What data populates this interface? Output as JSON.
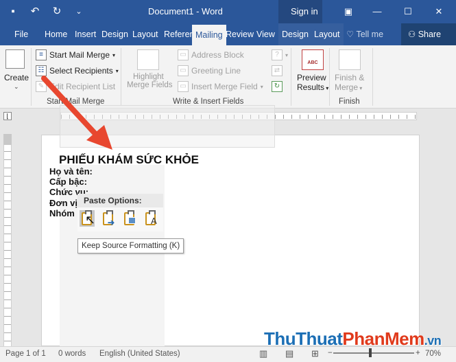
{
  "window": {
    "doc_title": "Document1  -  Word",
    "signin": "Sign in"
  },
  "qat": [
    "save-icon",
    "undo-icon",
    "redo-icon",
    "customize-icon"
  ],
  "tabs": [
    {
      "label": "File"
    },
    {
      "label": "Home"
    },
    {
      "label": "Insert"
    },
    {
      "label": "Design"
    },
    {
      "label": "Layout"
    },
    {
      "label": "Referer"
    },
    {
      "label": "Mailing"
    },
    {
      "label": "Review"
    },
    {
      "label": "View"
    },
    {
      "label": "Design"
    },
    {
      "label": "Layout"
    }
  ],
  "tellme": "Tell me",
  "share": "Share",
  "ribbon": {
    "create": "Create",
    "start_mail_merge": "Start Mail Merge",
    "select_recipients": "Select Recipients",
    "edit_recipient_list": "Edit Recipient List",
    "group_start": "Start Mail Merge",
    "highlight_merge_fields": [
      "Highlight",
      "Merge Fields"
    ],
    "address_block": "Address Block",
    "greeting_line": "Greeting Line",
    "insert_merge_field": "Insert Merge Field",
    "group_write": "Write & Insert Fields",
    "preview_results": [
      "Preview",
      "Results"
    ],
    "finish_merge": [
      "Finish &",
      "Merge"
    ],
    "group_finish": "Finish",
    "abc": "ABC"
  },
  "document": {
    "title": "PHIẾU KHÁM SỨC KHỎE",
    "fields": [
      "Họ và tên:",
      "Cấp bậc:",
      "Chức vụ:",
      "Đơn vị",
      "Nhóm"
    ]
  },
  "paste": {
    "header": "Paste Options:",
    "tooltip": "Keep Source Formatting (K)",
    "icons": [
      "keep-source-formatting-icon",
      "merge-formatting-icon",
      "picture-icon",
      "keep-text-only-icon"
    ]
  },
  "status": {
    "page": "Page 1 of 1",
    "words": "0 words",
    "language": "English (United States)",
    "zoom": "70%"
  },
  "watermark": {
    "part1": "ThuThuat",
    "part2": "PhanMem",
    "part3": ".vn"
  },
  "colors": {
    "accent": "#2b579a",
    "arrow": "#e8472f"
  }
}
